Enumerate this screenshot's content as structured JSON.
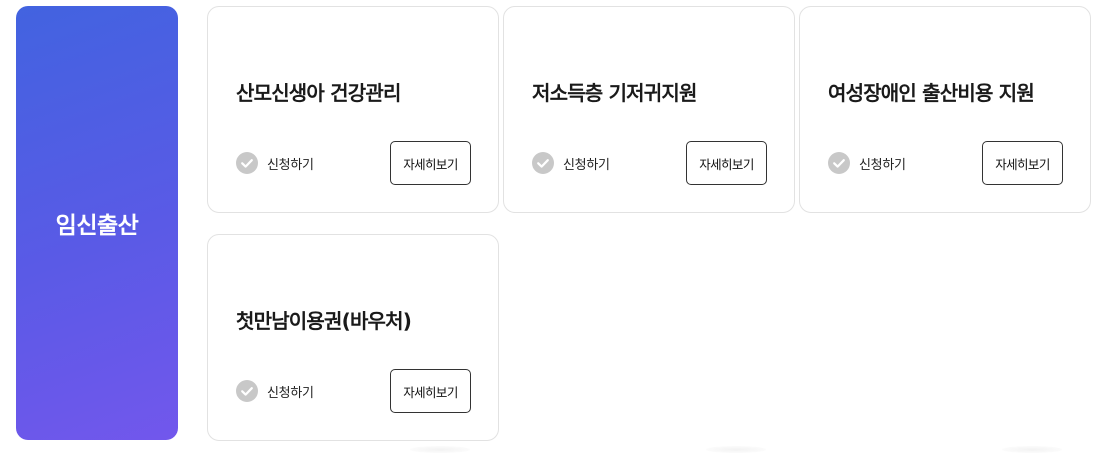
{
  "category": {
    "title": "임신출산"
  },
  "cards": [
    {
      "title": "산모신생아 건강관리",
      "apply_label": "신청하기",
      "detail_label": "자세히보기"
    },
    {
      "title": "저소득층 기저귀지원",
      "apply_label": "신청하기",
      "detail_label": "자세히보기"
    },
    {
      "title": "여성장애인 출산비용 지원",
      "apply_label": "신청하기",
      "detail_label": "자세히보기"
    },
    {
      "title": "첫만남이용권(바우처)",
      "apply_label": "신청하기",
      "detail_label": "자세히보기"
    }
  ],
  "icons": {
    "apply": "check-circle-icon"
  },
  "colors": {
    "panel_gradient_start": "#4263e0",
    "panel_gradient_end": "#7257ec",
    "check_icon": "#c8c8c8",
    "card_border": "#e2e2e2"
  }
}
